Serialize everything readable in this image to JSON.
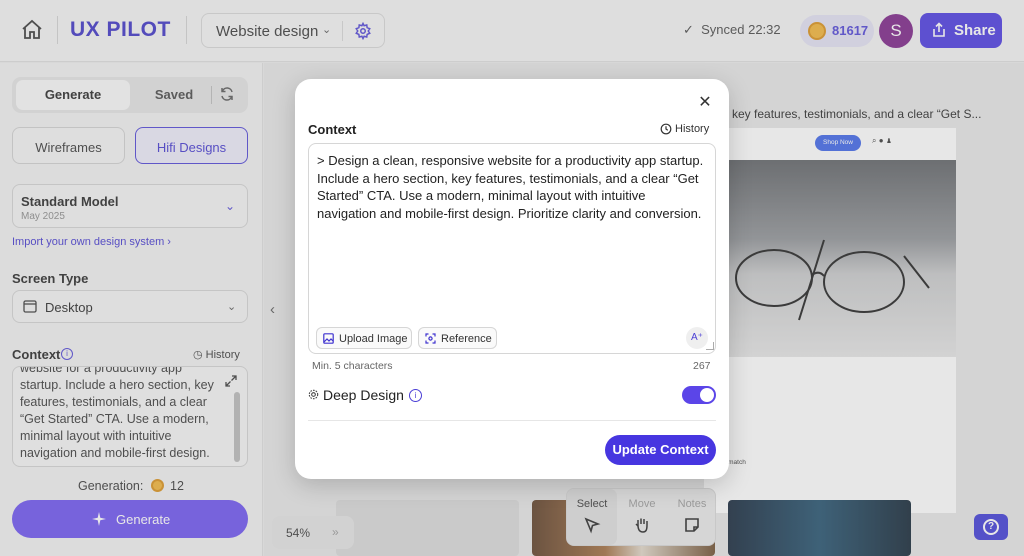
{
  "header": {
    "logo": "UX PILOT",
    "project": "Website design",
    "sync_status": "Synced 22:32",
    "credits": "81617",
    "avatar_initial": "S",
    "share_label": "Share"
  },
  "sidebar": {
    "tabs": {
      "generate": "Generate",
      "saved": "Saved"
    },
    "design_types": [
      "Wireframes",
      "Hifi Designs"
    ],
    "selected_design_type": "Hifi Designs",
    "model": {
      "name": "Standard Model",
      "date": "May 2025"
    },
    "import_link": "Import your own design system  ›",
    "screen_type": {
      "label": "Screen Type",
      "value": "Desktop"
    },
    "context": {
      "label": "Context",
      "history": "History",
      "text": "website for a productivity app startup. Include a hero section, key features, testimonials, and a clear “Get Started” CTA. Use a modern, minimal layout with intuitive navigation and mobile-first design."
    },
    "generation": {
      "label": "Generation:",
      "count": "12"
    },
    "generate_button": "Generate"
  },
  "canvas": {
    "prompt_snippet": "key features, testimonials, and a clear “Get S...",
    "preview_button": "Shop Now",
    "preview_caption": "tes that match",
    "zoom": "54%",
    "tools": [
      "Select",
      "Move",
      "Notes"
    ],
    "active_tool": "Select"
  },
  "modal": {
    "context_label": "Context",
    "history": "History",
    "context_text": "> Design a clean, responsive website for a productivity app startup. Include a hero section, key features, testimonials, and a clear “Get Started” CTA. Use a modern, minimal layout with intuitive navigation and mobile-first design. Prioritize clarity and conversion.",
    "upload_image": "Upload Image",
    "reference": "Reference",
    "min_chars": "Min. 5 characters",
    "char_count": "267",
    "deep_design": "Deep Design",
    "deep_design_enabled": true,
    "update_button": "Update Context"
  },
  "colors": {
    "brand": "#4736e0",
    "accent_light": "#ecebfa",
    "generate_button": "#6a4ff0"
  },
  "icons": [
    "home-icon",
    "gear-icon",
    "check-icon",
    "coin-icon",
    "share-icon",
    "refresh-icon",
    "chevron-down-icon",
    "monitor-icon",
    "info-icon",
    "history-icon",
    "expand-icon",
    "sparkle-icon",
    "chevron-left-icon",
    "close-icon",
    "image-icon",
    "reference-icon",
    "enhance-icon",
    "cursor-icon",
    "hand-icon",
    "note-icon",
    "help-icon"
  ]
}
